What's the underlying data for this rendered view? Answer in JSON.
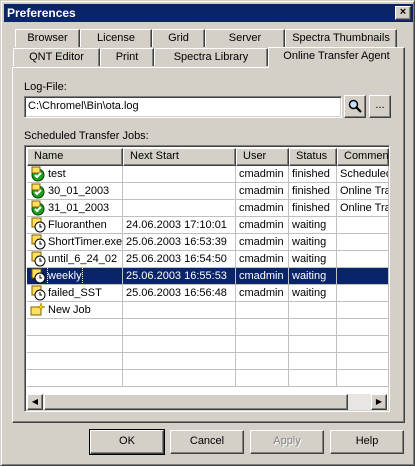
{
  "window": {
    "title": "Preferences",
    "close_glyph": "×"
  },
  "tabs_back": [
    {
      "label": "Browser"
    },
    {
      "label": "License"
    },
    {
      "label": "Grid"
    },
    {
      "label": "Server"
    },
    {
      "label": "Spectra Thumbnails"
    }
  ],
  "tabs_front": [
    {
      "label": "QNT Editor"
    },
    {
      "label": "Print"
    },
    {
      "label": "Spectra Library"
    },
    {
      "label": "Online Transfer Agent",
      "active": true
    }
  ],
  "logfile": {
    "label": "Log-File:",
    "value": "C:\\Chromel\\Bin\\ota.log",
    "browse_label": "..."
  },
  "jobs": {
    "label": "Scheduled Transfer Jobs:",
    "columns": [
      "Name",
      "Next Start",
      "User",
      "Status",
      "Comment"
    ],
    "rows": [
      {
        "name": "test",
        "next_start": "",
        "user": "cmadmin",
        "status": "finished",
        "comment": "Scheduled",
        "icon": "finished-check-icon"
      },
      {
        "name": "30_01_2003",
        "next_start": "",
        "user": "cmadmin",
        "status": "finished",
        "comment": "Online Tra",
        "icon": "finished-check-icon"
      },
      {
        "name": "31_01_2003",
        "next_start": "",
        "user": "cmadmin",
        "status": "finished",
        "comment": "Online Tra",
        "icon": "finished-check-icon"
      },
      {
        "name": "Fluoranthen",
        "next_start": "24.06.2003 17:10:01",
        "user": "cmadmin",
        "status": "waiting",
        "comment": "",
        "icon": "waiting-clock-icon"
      },
      {
        "name": "ShortTimer.exe",
        "next_start": "25.06.2003 16:53:39",
        "user": "cmadmin",
        "status": "waiting",
        "comment": "",
        "icon": "waiting-clock-icon"
      },
      {
        "name": "until_6_24_02",
        "next_start": "25.06.2003 16:54:50",
        "user": "cmadmin",
        "status": "waiting",
        "comment": "",
        "icon": "waiting-clock-icon"
      },
      {
        "name": "weekly",
        "next_start": "25.06.2003 16:55:53",
        "user": "cmadmin",
        "status": "waiting",
        "comment": "",
        "icon": "waiting-clock-icon",
        "selected": true
      },
      {
        "name": "failed_SST",
        "next_start": "25.06.2003 16:56:48",
        "user": "cmadmin",
        "status": "waiting",
        "comment": "",
        "icon": "waiting-clock-icon"
      },
      {
        "name": "New Job",
        "next_start": "",
        "user": "",
        "status": "",
        "comment": "",
        "icon": "new-job-icon"
      }
    ]
  },
  "buttons": {
    "ok": "OK",
    "cancel": "Cancel",
    "apply": "Apply",
    "help": "Help"
  },
  "colors": {
    "selection": "#0a246a",
    "titlebar": "#0a246a",
    "face": "#d4d0c8"
  }
}
